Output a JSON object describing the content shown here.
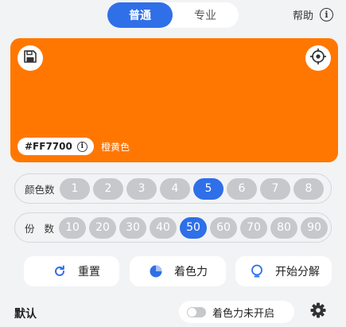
{
  "mode_switch": {
    "tabs": [
      "普通",
      "专业"
    ],
    "active_index": 0
  },
  "help": {
    "label": "帮助",
    "icon": "info-icon"
  },
  "preview": {
    "color": "#FF7700",
    "hex_label": "#FF7700",
    "color_name": "橙黄色",
    "save_icon": "save-icon",
    "target_icon": "crosshair-icon"
  },
  "color_count": {
    "label": "颜色数",
    "options": [
      "1",
      "2",
      "3",
      "4",
      "5",
      "6",
      "7",
      "8"
    ],
    "selected": "5"
  },
  "parts": {
    "label": "份数",
    "options": [
      "10",
      "20",
      "30",
      "40",
      "50",
      "60",
      "70",
      "80",
      "90"
    ],
    "selected": "50"
  },
  "actions": {
    "reset": "重置",
    "coloring": "着色力",
    "start": "开始分解"
  },
  "bottom": {
    "default_label": "默认",
    "toggle_label": "着色力未开启",
    "toggle_on": false
  },
  "colors": {
    "accent": "#2f6fe8",
    "chip_off": "#c7c8cb",
    "preview": "#FF7700"
  }
}
